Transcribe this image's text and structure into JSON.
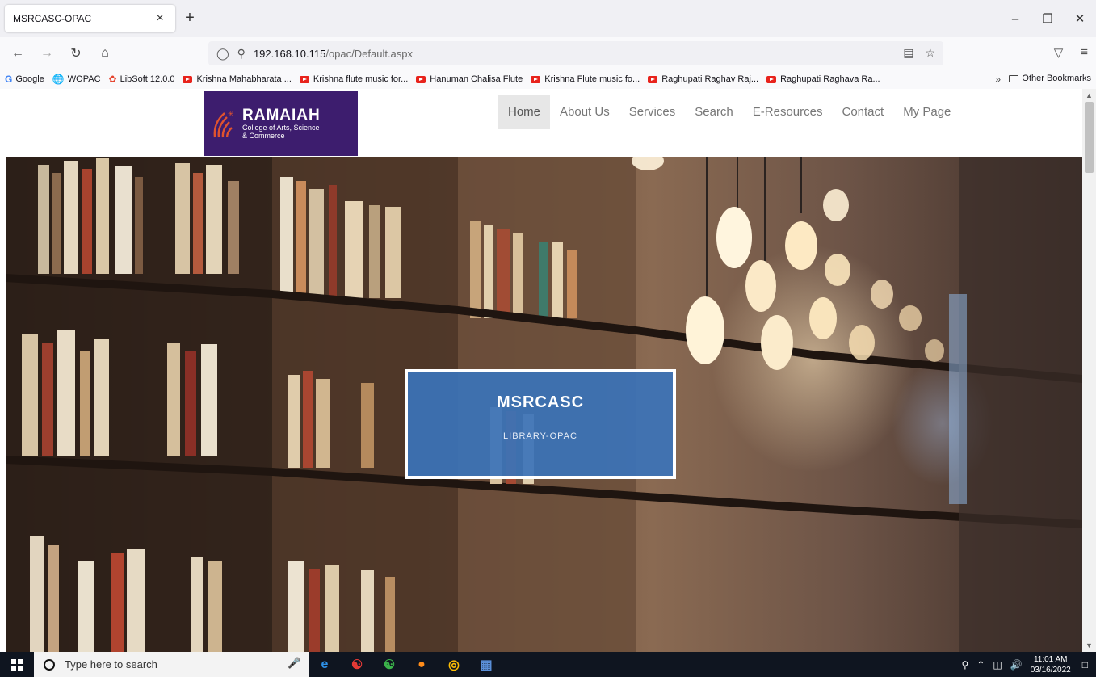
{
  "browser": {
    "tab_title": "MSRCASC-OPAC",
    "tab_close": "×",
    "new_tab": "+",
    "url_host": "192.168.10.115",
    "url_path": "/opac/Default.aspx",
    "bookmarks": [
      {
        "label": "Google",
        "icon": "google-icon"
      },
      {
        "label": "WOPAC",
        "icon": "globe-icon"
      },
      {
        "label": "LibSoft 12.0.0",
        "icon": "libsoft-icon"
      },
      {
        "label": "Krishna Mahabharata ...",
        "icon": "youtube-icon"
      },
      {
        "label": "Krishna flute music for...",
        "icon": "youtube-icon"
      },
      {
        "label": "Hanuman Chalisa Flute",
        "icon": "youtube-icon"
      },
      {
        "label": "Krishna Flute music fo...",
        "icon": "youtube-icon"
      },
      {
        "label": "Raghupati Raghav Raj...",
        "icon": "youtube-icon"
      },
      {
        "label": "Raghupati Raghava Ra...",
        "icon": "youtube-icon"
      }
    ],
    "other_bookmarks": "Other Bookmarks"
  },
  "site": {
    "logo_name": "RAMAIAH",
    "logo_sub_1": "College of Arts, Science",
    "logo_sub_2": "& Commerce",
    "nav": [
      "Home",
      "About Us",
      "Services",
      "Search",
      "E-Resources",
      "Contact",
      "My Page"
    ],
    "active_nav": "Home",
    "hero_title": "MSRCASC",
    "hero_subtitle": "LIBRARY-OPAC"
  },
  "taskbar": {
    "search_placeholder": "Type here to search",
    "time": "11:01 AM",
    "date": "03/16/2022"
  },
  "colors": {
    "logo_bg": "#3d1d6e",
    "hero_card": "#3b73b9",
    "taskbar": "#0f1520"
  }
}
